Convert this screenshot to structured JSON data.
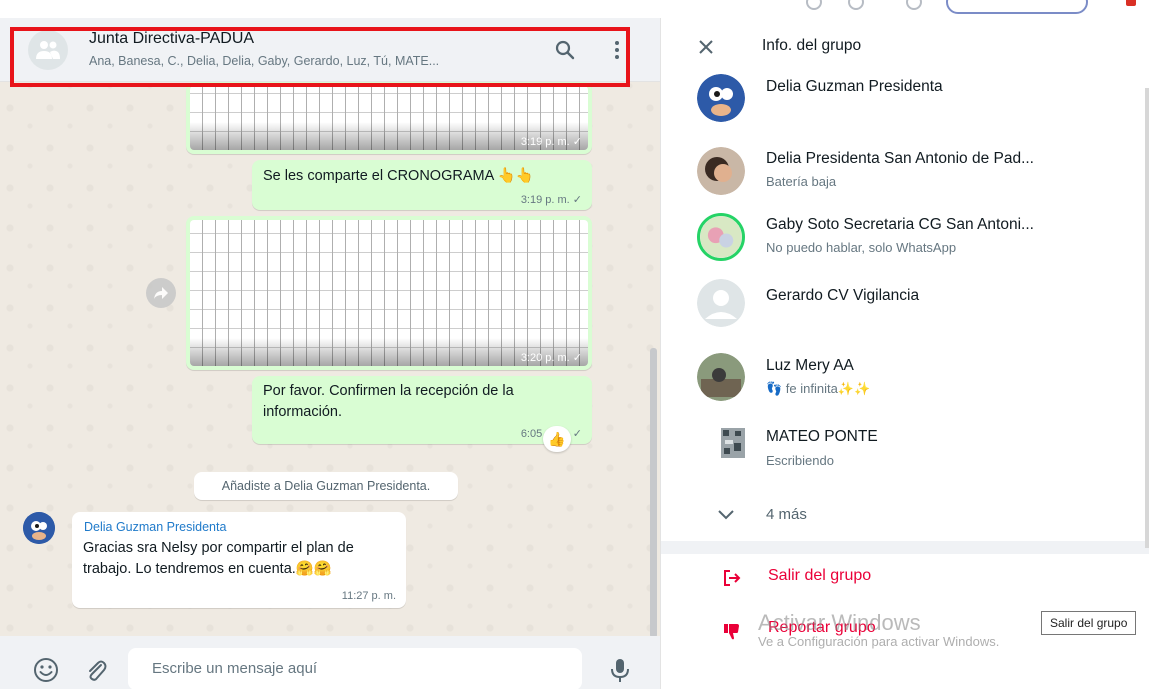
{
  "chat": {
    "group_name": "Junta Directiva-PADUA",
    "members": "Ana, Banesa, C., Delia, Delia, Gaby, Gerardo, Luz, Tú, MATE...",
    "messages": {
      "img1_time": "3:19 p. m. ✓",
      "cronograma_text": "Se les comparte el CRONOGRAMA 👆👆",
      "cronograma_time": "3:19 p. m. ✓",
      "img2_time": "3:20 p. m. ✓",
      "confirm_text": "Por favor. Confirmen la recepción de la información.",
      "confirm_time": "6:05 p. m. ✓",
      "reaction": "👍",
      "system_text": "Añadiste a Delia Guzman Presidenta.",
      "incoming_sender": "Delia Guzman Presidenta",
      "incoming_text": "Gracias sra Nelsy por compartir el plan de trabajo. Lo tendremos en cuenta.🤗🤗",
      "incoming_time": "11:27 p. m."
    },
    "composer_placeholder": "Escribe un mensaje aquí"
  },
  "info": {
    "title": "Info. del grupo",
    "members": [
      {
        "name": "Delia Guzman Presidenta",
        "status": ""
      },
      {
        "name": "Delia Presidenta San Antonio de Pad...",
        "status": "Batería baja"
      },
      {
        "name": "Gaby Soto Secretaria CG San Antoni...",
        "status": "No puedo hablar, solo WhatsApp"
      },
      {
        "name": "Gerardo CV Vigilancia",
        "status": ""
      },
      {
        "name": "Luz Mery AA",
        "status": "👣 fe infinita✨✨"
      },
      {
        "name": "MATEO PONTE",
        "status": "Escribiendo"
      }
    ],
    "more_label": "4 más",
    "exit_label": "Salir del grupo",
    "report_label": "Reportar grupo"
  },
  "overlay": {
    "activate_title": "Activar Windows",
    "activate_sub": "Ve a Configuración para activar Windows.",
    "tooltip": "Salir del grupo"
  },
  "colors": {
    "accent_red_box": "#e8141a",
    "outgoing_bubble": "#d9fdd3",
    "danger": "#ea0038",
    "sender_name": "#1f7aca"
  }
}
